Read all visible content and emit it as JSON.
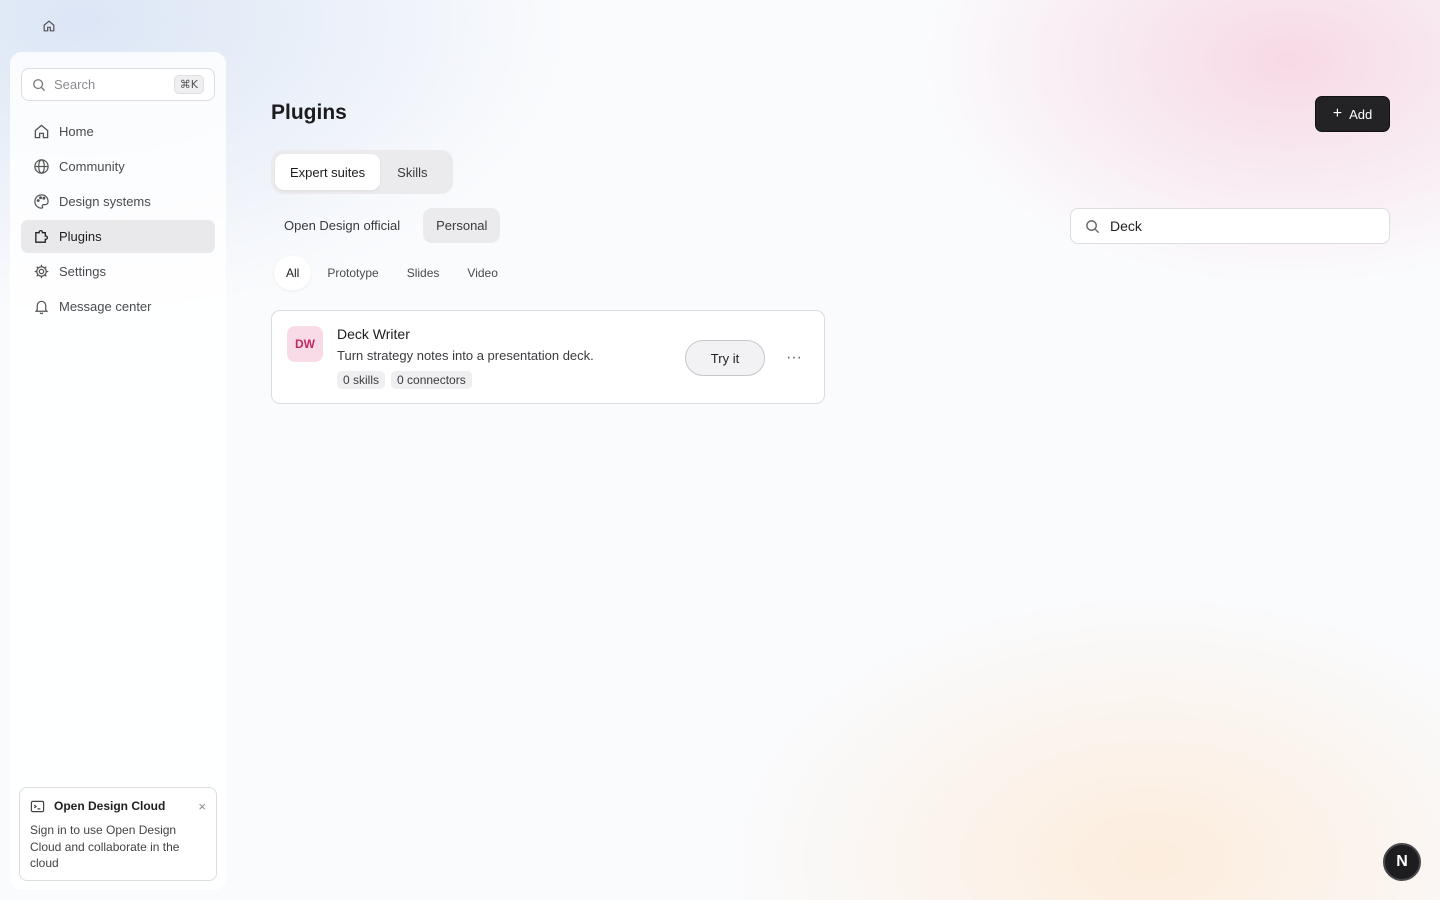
{
  "sidebar": {
    "search": {
      "placeholder": "Search",
      "shortcut": "⌘K"
    },
    "items": [
      {
        "label": "Home",
        "icon": "home-icon"
      },
      {
        "label": "Community",
        "icon": "globe-icon"
      },
      {
        "label": "Design systems",
        "icon": "palette-icon"
      },
      {
        "label": "Plugins",
        "icon": "puzzle-icon",
        "active": true
      },
      {
        "label": "Settings",
        "icon": "gear-icon"
      },
      {
        "label": "Message center",
        "icon": "bell-icon"
      }
    ],
    "cloud": {
      "title": "Open Design Cloud",
      "close": "×",
      "text": "Sign in to use Open Design Cloud and collaborate in the cloud"
    }
  },
  "main": {
    "title": "Plugins",
    "add_label": "Add",
    "segment_tabs": [
      {
        "label": "Expert suites",
        "active": true
      },
      {
        "label": "Skills",
        "active": false
      }
    ],
    "filters": [
      {
        "label": "Open Design official",
        "active": false
      },
      {
        "label": "Personal",
        "active": true
      }
    ],
    "search_value": "Deck",
    "type_tabs": [
      {
        "label": "All",
        "active": true
      },
      {
        "label": "Prototype",
        "active": false
      },
      {
        "label": "Slides",
        "active": false
      },
      {
        "label": "Video",
        "active": false
      }
    ],
    "plugins": [
      {
        "initials": "DW",
        "name": "Deck Writer",
        "description": "Turn strategy notes into a presentation deck.",
        "skills": "0 skills",
        "connectors": "0 connectors",
        "action_label": "Try it",
        "more_label": "···"
      }
    ]
  },
  "user_badge": "N",
  "colors": {
    "accent_dark": "#232325",
    "avatar_bg": "#f8dbe6",
    "avatar_text": "#c02a66",
    "active_nav": "#e9e9ec"
  }
}
